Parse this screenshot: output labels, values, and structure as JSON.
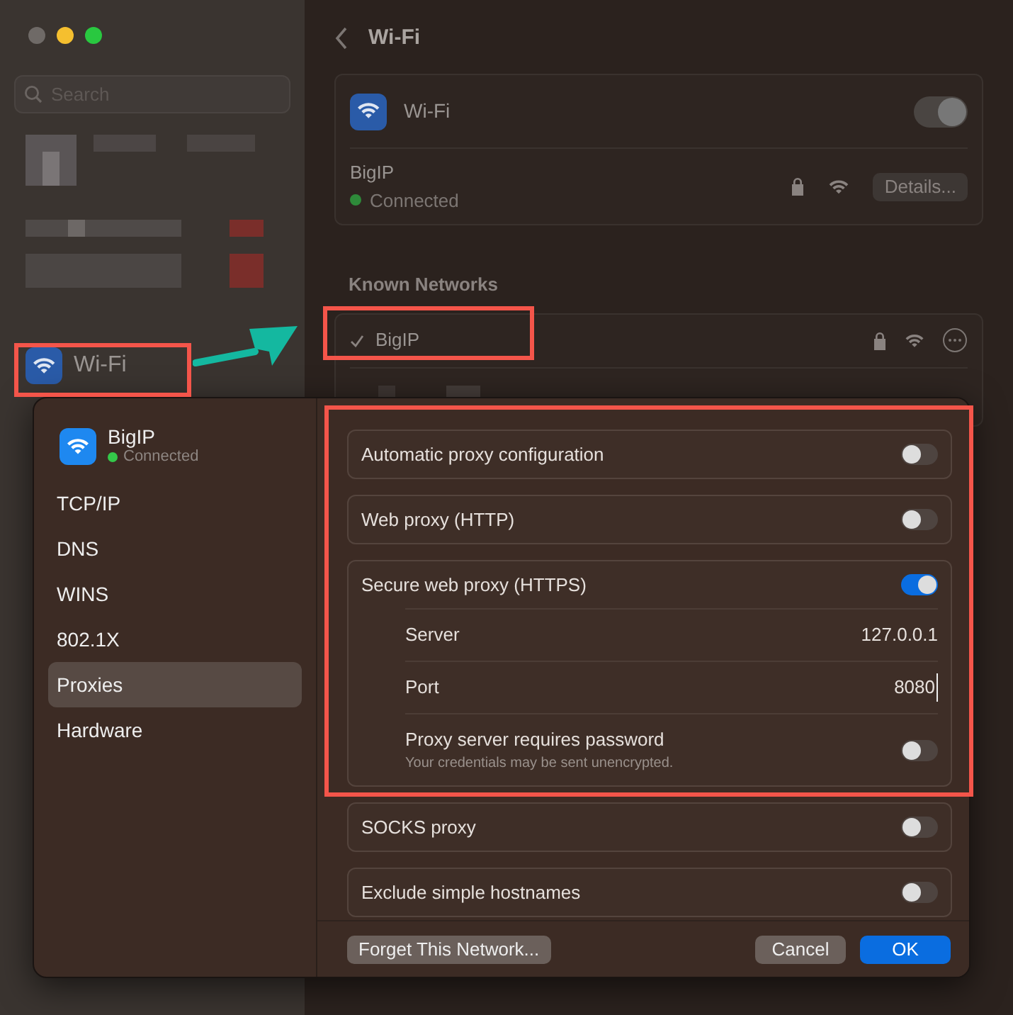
{
  "sidebar": {
    "search": {
      "placeholder": "Search"
    },
    "items": [
      {
        "label": "Wi-Fi"
      }
    ]
  },
  "page": {
    "title": "Wi-Fi",
    "wifi_card": {
      "label": "Wi-Fi",
      "on": true,
      "network": "BigIP",
      "status": "Connected",
      "details_button": "Details..."
    },
    "known_networks": {
      "heading": "Known Networks",
      "items": [
        {
          "name": "BigIP",
          "checked": true
        }
      ]
    }
  },
  "sheet": {
    "network": "BigIP",
    "status": "Connected",
    "nav": [
      {
        "label": "TCP/IP",
        "selected": false
      },
      {
        "label": "DNS",
        "selected": false
      },
      {
        "label": "WINS",
        "selected": false
      },
      {
        "label": "802.1X",
        "selected": false
      },
      {
        "label": "Proxies",
        "selected": true
      },
      {
        "label": "Hardware",
        "selected": false
      }
    ],
    "proxies": [
      {
        "label": "Automatic proxy configuration",
        "on": false
      },
      {
        "label": "Web proxy (HTTP)",
        "on": false
      },
      {
        "label": "Secure web proxy (HTTPS)",
        "on": true,
        "fields": [
          {
            "label": "Server",
            "value": "127.0.0.1"
          },
          {
            "label": "Port",
            "value": "8080"
          }
        ],
        "password": {
          "label": "Proxy server requires password",
          "note": "Your credentials may be sent unencrypted.",
          "on": false
        }
      },
      {
        "label": "SOCKS proxy",
        "on": false
      },
      {
        "label": "Exclude simple hostnames",
        "on": false
      }
    ],
    "buttons": {
      "forget": "Forget This Network...",
      "cancel": "Cancel",
      "ok": "OK"
    }
  }
}
